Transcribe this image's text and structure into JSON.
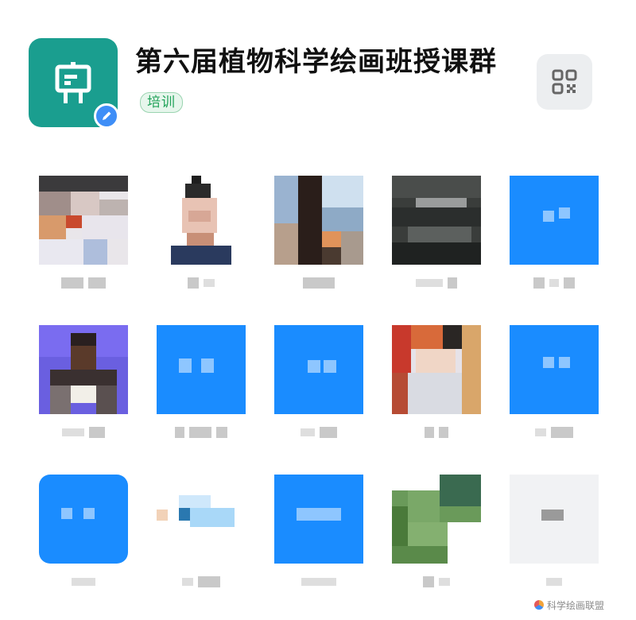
{
  "group": {
    "title": "第六届植物科学绘画班授课群",
    "tag": "培训"
  },
  "members": [
    {
      "avatar": "photo-people"
    },
    {
      "avatar": "photo-portrait"
    },
    {
      "avatar": "photo-long-hair"
    },
    {
      "avatar": "photo-dark"
    },
    {
      "avatar": "default-blue"
    },
    {
      "avatar": "photo-purple"
    },
    {
      "avatar": "default-blue"
    },
    {
      "avatar": "default-blue"
    },
    {
      "avatar": "photo-red"
    },
    {
      "avatar": "default-blue"
    },
    {
      "avatar": "default-blue"
    },
    {
      "avatar": "illustration-light-blue"
    },
    {
      "avatar": "default-blue"
    },
    {
      "avatar": "photo-green-plant"
    },
    {
      "avatar": "default-gray"
    }
  ],
  "watermark": {
    "text": "科学绘画联盟"
  },
  "colors": {
    "group_avatar": "#1a9e8f",
    "tag_green": "#22a35a",
    "default_avatar_blue": "#1a8cff",
    "edit_badge": "#3e8ef7"
  }
}
